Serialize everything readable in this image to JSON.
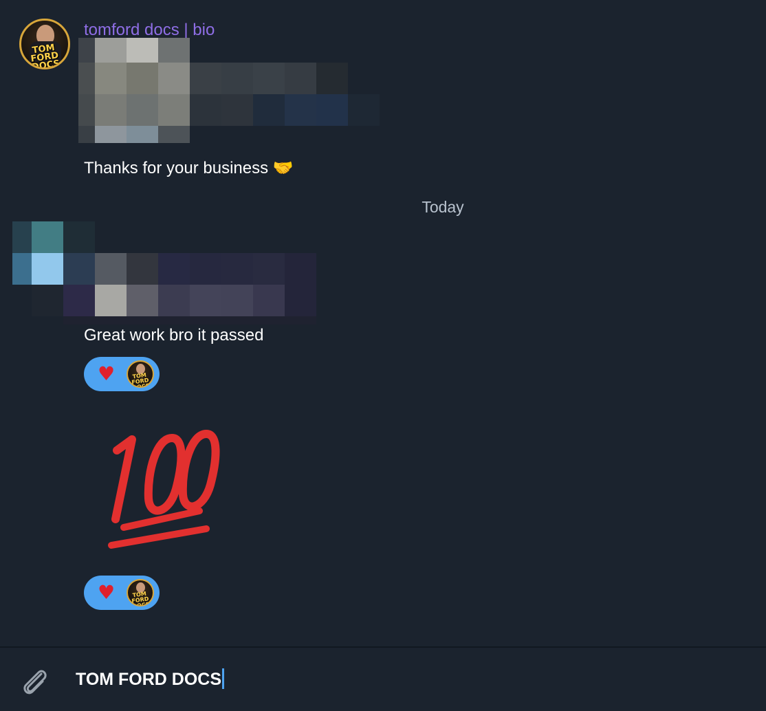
{
  "chat": {
    "sender_name": "tomford docs | bio",
    "avatar_label": "TOM FORD DOCS",
    "messages": [
      {
        "text": "Thanks for your business 🤝"
      },
      {
        "text": "Great work bro it passed"
      }
    ],
    "date_separator": "Today",
    "reactions": [
      {
        "emoji": "♥"
      },
      {
        "emoji": "♥"
      }
    ],
    "sticker": "💯"
  },
  "composer": {
    "input_value": "TOM FORD DOCS",
    "attach_icon": "paperclip-icon"
  },
  "colors": {
    "background": "#1b232e",
    "sender": "#8f6ee6",
    "reaction_bg": "#4ea3f1",
    "caret": "#4ea3f1"
  }
}
